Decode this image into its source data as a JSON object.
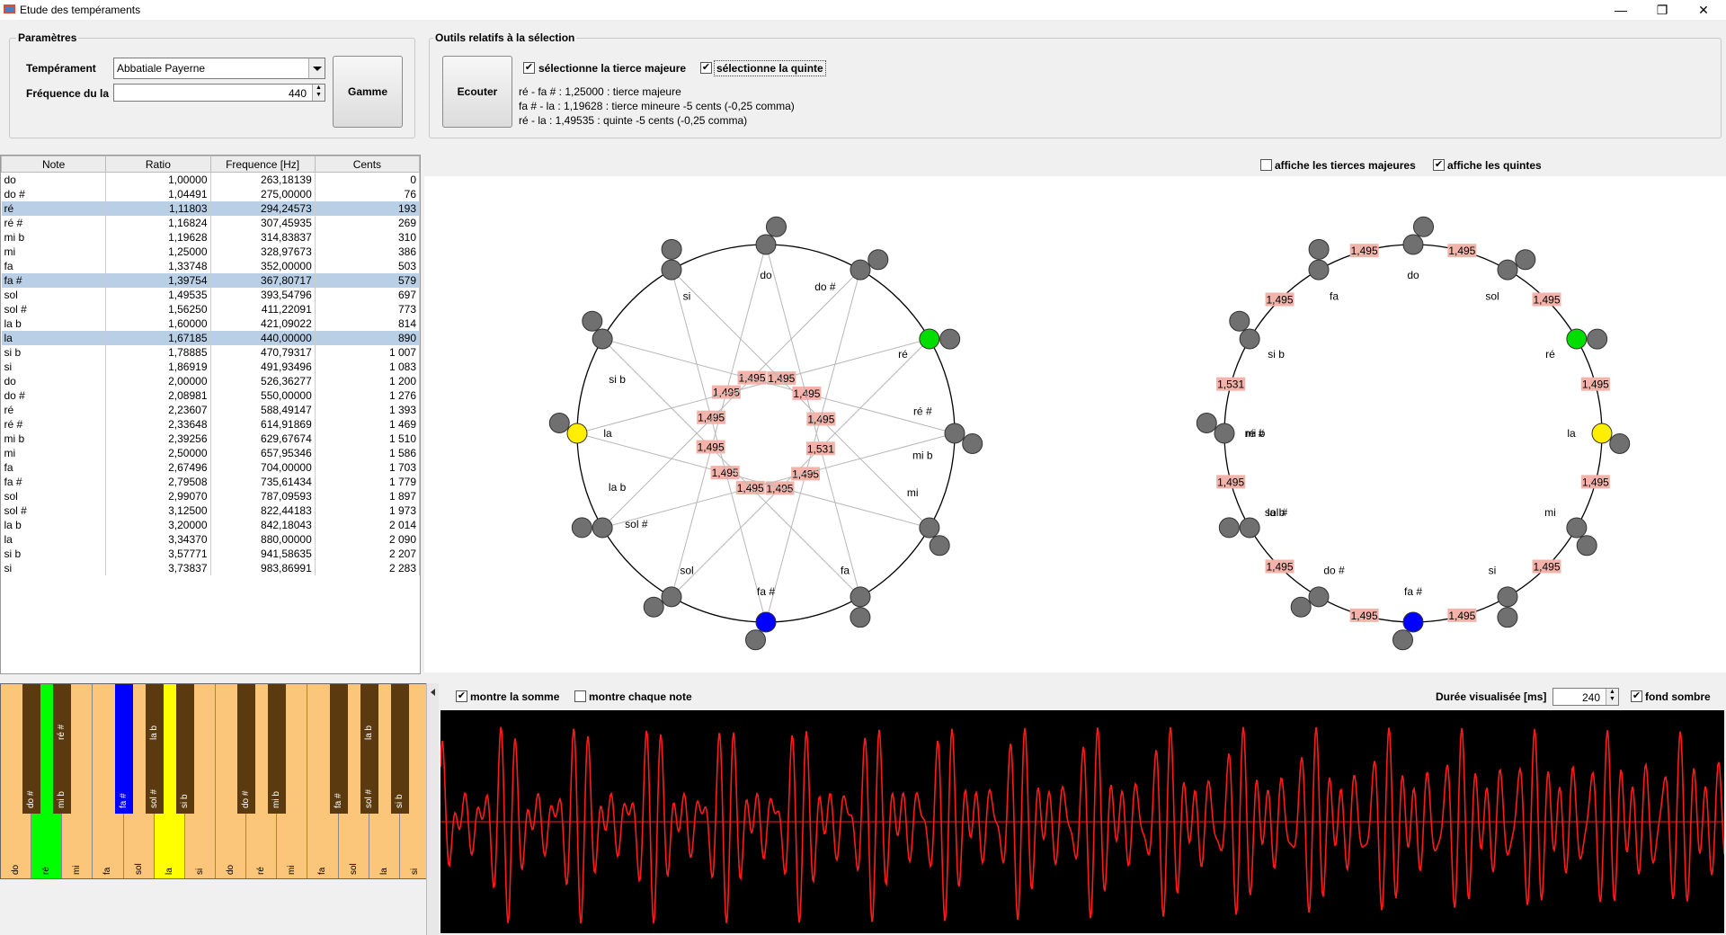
{
  "window": {
    "title": "Etude des tempéraments",
    "minimize": "—",
    "restore": "❐",
    "close": "✕"
  },
  "params": {
    "title": "Paramètres",
    "temperament_label": "Tempérament",
    "temperament_value": "Abbatiale Payerne",
    "freq_label": "Fréquence du la",
    "freq_value": "440",
    "gamme_button": "Gamme"
  },
  "tools": {
    "title": "Outils relatifs à la sélection",
    "ecouter_button": "Ecouter",
    "chk_tierce_label": "sélectionne la tierce majeure",
    "chk_quinte_label": "sélectionne la quinte",
    "chk_tierce_checked": true,
    "chk_quinte_checked": true,
    "info_lines": [
      "ré - fa # : 1,25000 : tierce majeure",
      "fa # - la : 1,19628 : tierce mineure -5 cents (-0,25 comma)",
      "ré - la : 1,49535 : quinte -5 cents (-0,25 comma)"
    ]
  },
  "table": {
    "columns": [
      "Note",
      "Ratio",
      "Frequence [Hz]",
      "Cents"
    ],
    "rows": [
      [
        "do",
        "1,00000",
        "263,18139",
        "0"
      ],
      [
        "do #",
        "1,04491",
        "275,00000",
        "76"
      ],
      [
        "ré",
        "1,11803",
        "294,24573",
        "193"
      ],
      [
        "ré #",
        "1,16824",
        "307,45935",
        "269"
      ],
      [
        "mi b",
        "1,19628",
        "314,83837",
        "310"
      ],
      [
        "mi",
        "1,25000",
        "328,97673",
        "386"
      ],
      [
        "fa",
        "1,33748",
        "352,00000",
        "503"
      ],
      [
        "fa #",
        "1,39754",
        "367,80717",
        "579"
      ],
      [
        "sol",
        "1,49535",
        "393,54796",
        "697"
      ],
      [
        "sol #",
        "1,56250",
        "411,22091",
        "773"
      ],
      [
        "la b",
        "1,60000",
        "421,09022",
        "814"
      ],
      [
        "la",
        "1,67185",
        "440,00000",
        "890"
      ],
      [
        "si b",
        "1,78885",
        "470,79317",
        "1 007"
      ],
      [
        "si",
        "1,86919",
        "491,93496",
        "1 083"
      ],
      [
        "do",
        "2,00000",
        "526,36277",
        "1 200"
      ],
      [
        "do #",
        "2,08981",
        "550,00000",
        "1 276"
      ],
      [
        "ré",
        "2,23607",
        "588,49147",
        "1 393"
      ],
      [
        "ré #",
        "2,33648",
        "614,91869",
        "1 469"
      ],
      [
        "mi b",
        "2,39256",
        "629,67674",
        "1 510"
      ],
      [
        "mi",
        "2,50000",
        "657,95346",
        "1 586"
      ],
      [
        "fa",
        "2,67496",
        "704,00000",
        "1 703"
      ],
      [
        "fa #",
        "2,79508",
        "735,61434",
        "1 779"
      ],
      [
        "sol",
        "2,99070",
        "787,09593",
        "1 897"
      ],
      [
        "sol #",
        "3,12500",
        "822,44183",
        "1 973"
      ],
      [
        "la b",
        "3,20000",
        "842,18043",
        "2 014"
      ],
      [
        "la",
        "3,34370",
        "880,00000",
        "2 090"
      ],
      [
        "si b",
        "3,57771",
        "941,58635",
        "2 207"
      ],
      [
        "si",
        "3,73837",
        "983,86991",
        "2 283"
      ]
    ],
    "selected_rows": [
      2,
      7,
      11
    ]
  },
  "circles": {
    "chk_tierces_label": "affiche les tierces majeures",
    "chk_quintes_label": "affiche les quintes",
    "chk_tierces_checked": false,
    "chk_quintes_checked": true,
    "left_notes": [
      "do",
      "do #",
      "ré",
      "ré #",
      "mi b",
      "mi",
      "fa",
      "fa #",
      "sol",
      "sol #",
      "la b",
      "la",
      "si b",
      "si"
    ],
    "left_values": [
      "1,495",
      "1,495",
      "1,495",
      "1,495",
      "1,495",
      "1,495",
      "1,495",
      "1,495",
      "1,495",
      "1,495",
      "1,495",
      "1,531"
    ],
    "right_notes": [
      "do",
      "sol",
      "ré",
      "la",
      "mi",
      "si",
      "fa #",
      "do #",
      "sol #",
      "la b",
      "ré #",
      "mi b",
      "si b",
      "fa"
    ],
    "right_values": [
      "1,495",
      "1,495",
      "1,495",
      "1,495",
      "1,495",
      "1,495",
      "1,495",
      "1,495",
      "1,495",
      "1,531",
      "1,495",
      "1,495"
    ],
    "colors": {
      "ring": "#000000",
      "node": "#707070",
      "re": "#00dd00",
      "la": "#ffee00",
      "fasharp": "#0000ff",
      "label_bg": "#f4b3aa",
      "line": "#b8b8b8"
    }
  },
  "piano": {
    "white_keys": [
      "do",
      "ré",
      "mi",
      "fa",
      "sol",
      "la",
      "si",
      "do",
      "ré",
      "mi",
      "fa",
      "sol",
      "la",
      "si"
    ],
    "black_keys": [
      "do #",
      "mi b",
      "fa #",
      "sol #",
      "si b",
      "do #",
      "mi b",
      "fa #",
      "sol #",
      "si b"
    ],
    "black_upper": [
      "",
      "ré #",
      "",
      "la b",
      "",
      "",
      "",
      "",
      "la b",
      ""
    ],
    "colors": {
      "white": "#fcc67a",
      "black": "#5a3a0e",
      "re_active": "#00ff00",
      "la_active": "#ffff00",
      "fasharp_active": "#0000ff"
    }
  },
  "wave": {
    "chk_somme_label": "montre la somme",
    "chk_chaque_label": "montre chaque note",
    "chk_somme_checked": true,
    "chk_chaque_checked": false,
    "duree_label": "Durée visualisée [ms]",
    "duree_value": "240",
    "fond_label": "fond sombre",
    "fond_checked": true,
    "colors": {
      "bg": "#000000",
      "wave": "#ff1a1a"
    }
  }
}
